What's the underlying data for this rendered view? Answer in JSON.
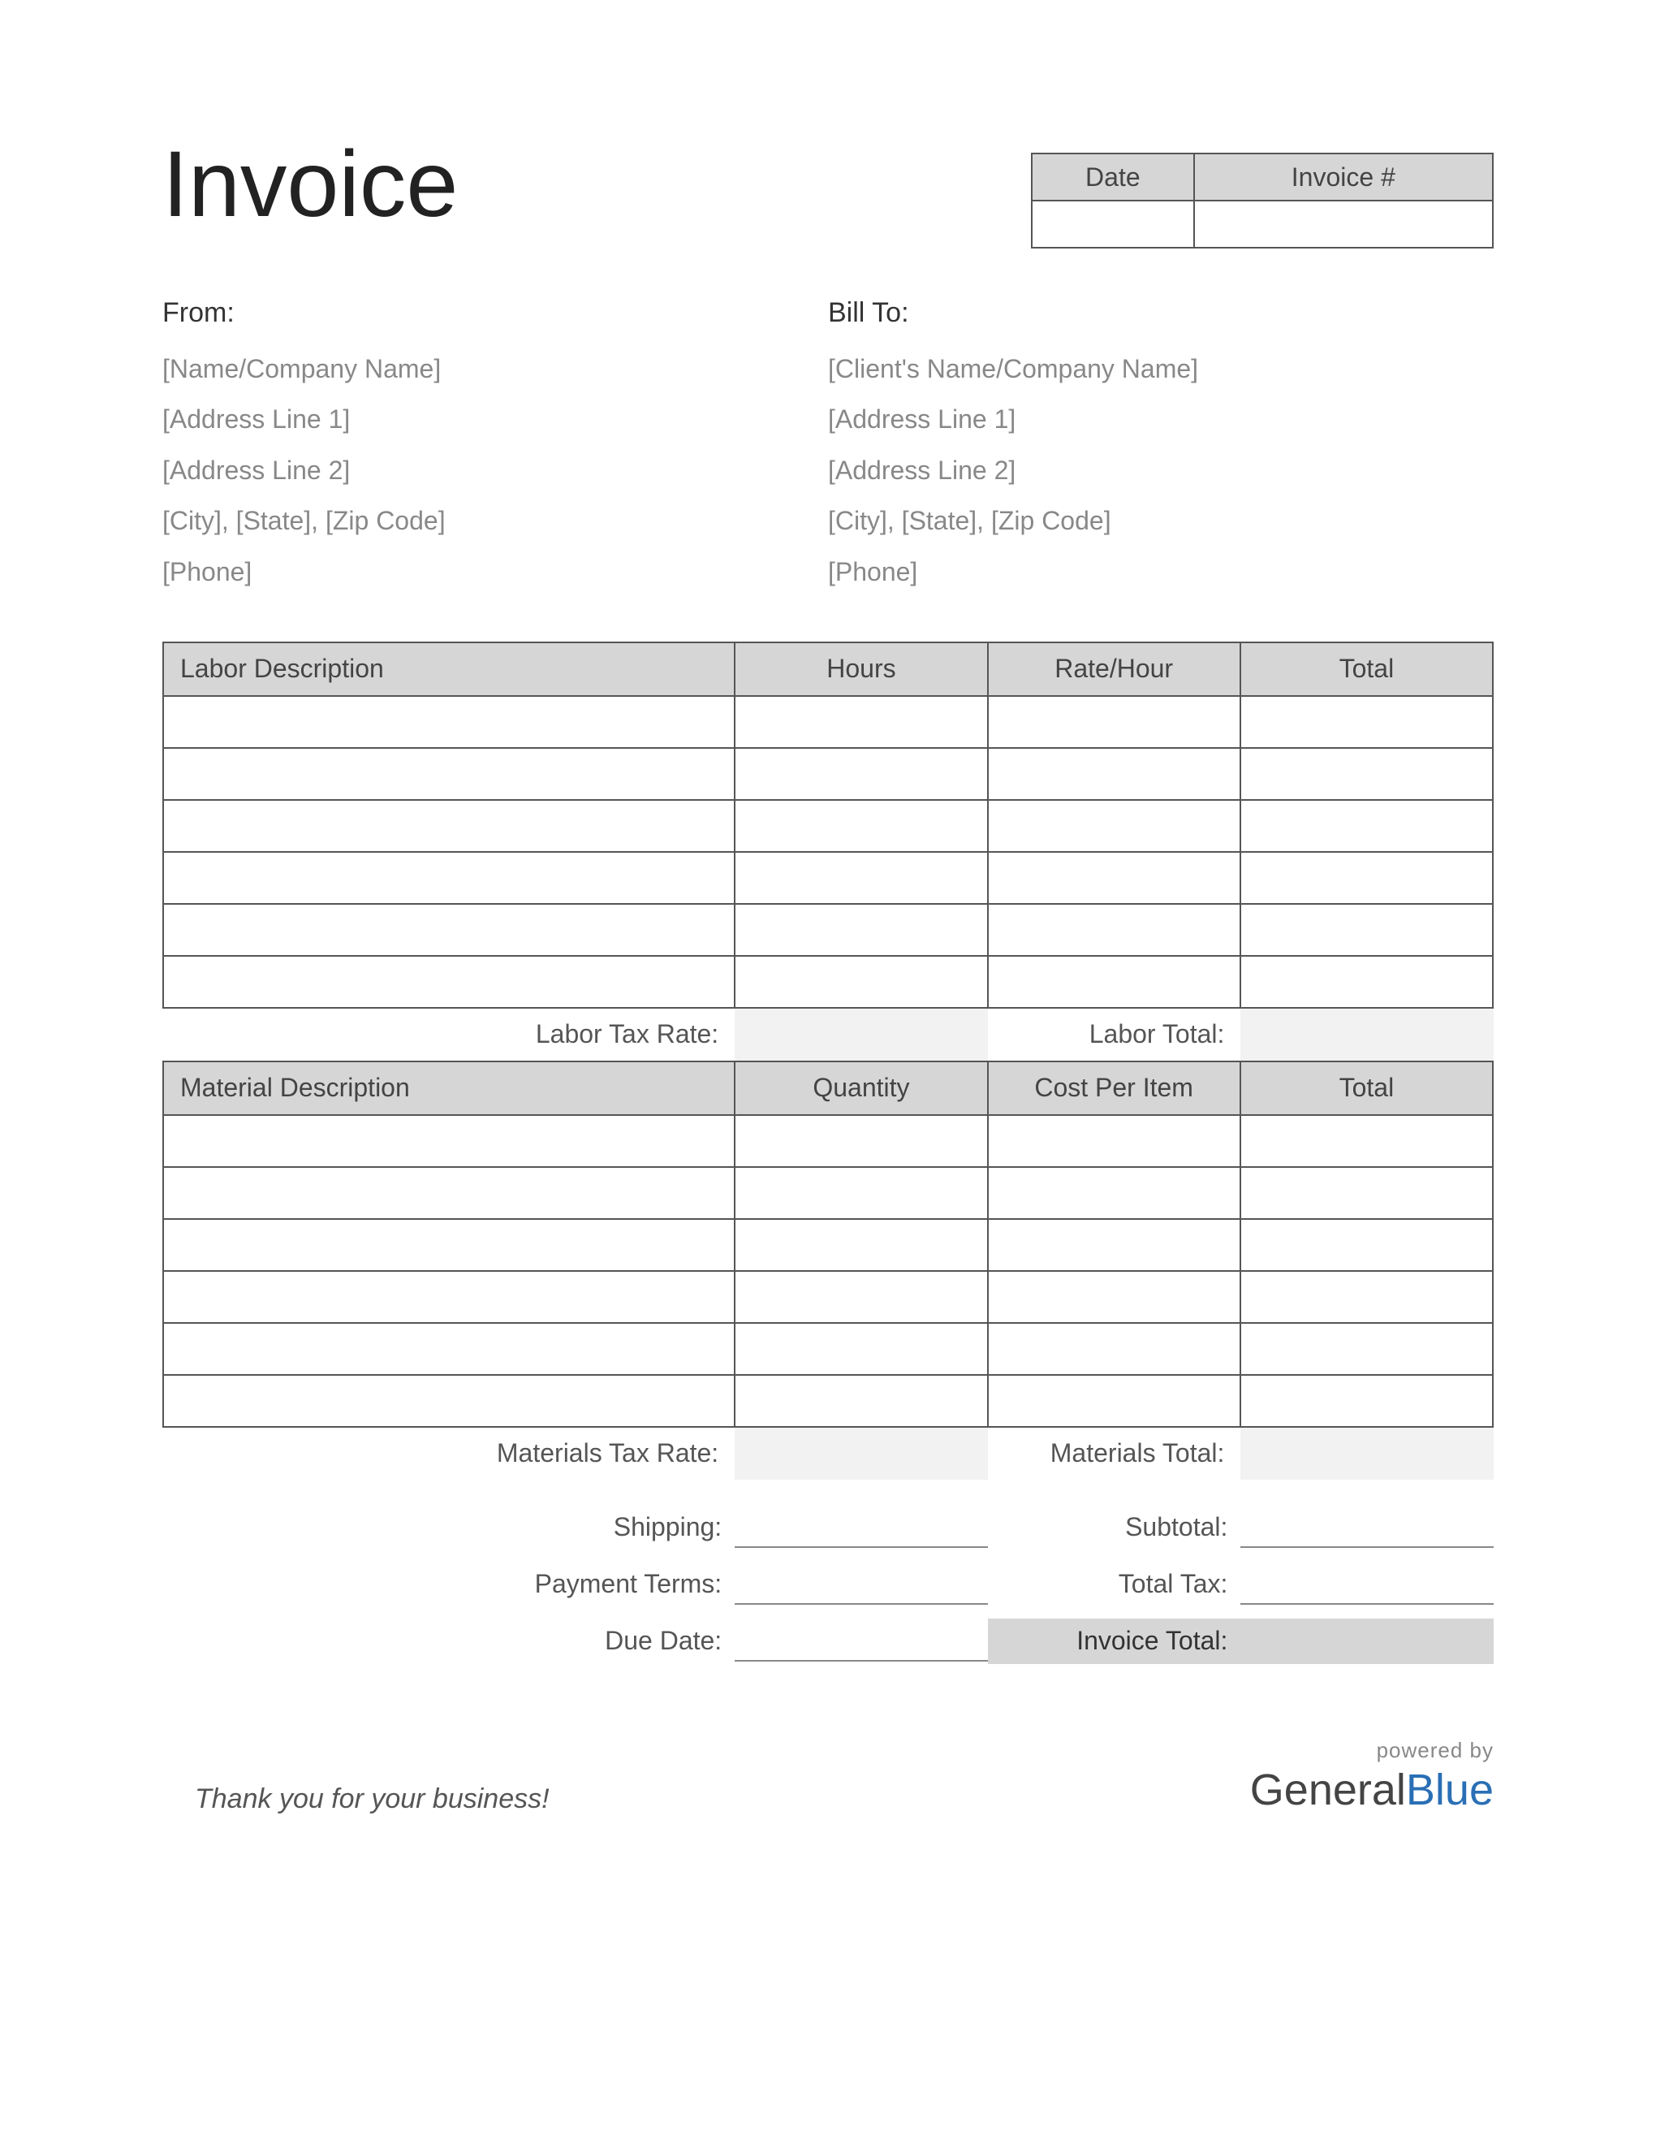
{
  "title": "Invoice",
  "meta": {
    "headers": [
      "Date",
      "Invoice #"
    ],
    "values": [
      "",
      ""
    ]
  },
  "from": {
    "label": "From:",
    "lines": [
      "[Name/Company Name]",
      "[Address Line 1]",
      "[Address Line 2]",
      "[City], [State], [Zip Code]",
      "[Phone]"
    ]
  },
  "billto": {
    "label": "Bill To:",
    "lines": [
      "[Client's Name/Company Name]",
      "[Address Line 1]",
      "[Address Line 2]",
      "[City], [State], [Zip Code]",
      "[Phone]"
    ]
  },
  "labor": {
    "headers": [
      "Labor Description",
      "Hours",
      "Rate/Hour",
      "Total"
    ],
    "row_count": 6,
    "tax_rate_label": "Labor Tax Rate:",
    "total_label": "Labor Total:"
  },
  "material": {
    "headers": [
      "Material Description",
      "Quantity",
      "Cost Per Item",
      "Total"
    ],
    "row_count": 6,
    "tax_rate_label": "Materials Tax Rate:",
    "total_label": "Materials Total:"
  },
  "summary": {
    "shipping_label": "Shipping:",
    "subtotal_label": "Subtotal:",
    "payment_terms_label": "Payment Terms:",
    "total_tax_label": "Total Tax:",
    "due_date_label": "Due Date:",
    "invoice_total_label": "Invoice Total:"
  },
  "footer": {
    "thanks": "Thank you for your business!",
    "powered_by": "powered by",
    "logo_a": "General",
    "logo_b": "Blue"
  }
}
